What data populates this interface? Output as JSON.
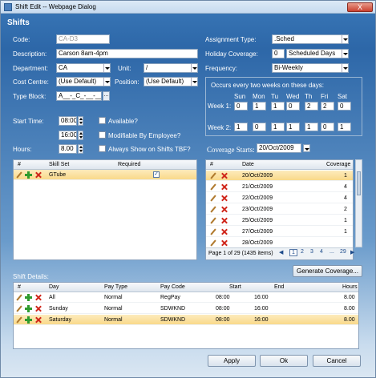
{
  "window": {
    "title": "Shift Edit -- Webpage Dialog",
    "close_glyph": "X"
  },
  "heading": "Shifts",
  "form": {
    "code_label": "Code:",
    "code_value": "CA-D3",
    "description_label": "Description:",
    "description_value": "Carson 8am-4pm",
    "department_label": "Department:",
    "department_value": "CA",
    "unit_label": "Unit:",
    "unit_value": "/",
    "cost_centre_label": "Cost Centre:",
    "cost_centre_value": "(Use Default)",
    "position_label": "Position:",
    "position_value": "(Use Default)",
    "type_block_label": "Type Block:",
    "type_block_value": "A__-_C_-__-__W",
    "ellipsis": "...",
    "start_time_label": "Start Time:",
    "start_time_value": "08:00",
    "end_time_value": "16:00",
    "hours_label": "Hours:",
    "hours_value": "8.00",
    "available_label": "Available?",
    "modifiable_label": "Modifiable By Employee?",
    "always_show_label": "Always Show on Shifts TBF?",
    "assignment_type_label": "Assignment Type:",
    "assignment_type_value": ".Sched",
    "holiday_coverage_label": "Holiday Coverage:",
    "holiday_coverage_value": "0",
    "holiday_coverage_unit": "Scheduled Days",
    "frequency_label": "Frequency:",
    "frequency_value": "Bi-Weekly"
  },
  "weeks": {
    "title": "Occurs every two weeks on these days:",
    "days": [
      "Sun",
      "Mon",
      "Tu",
      "Wed",
      "Th",
      "Fri",
      "Sat"
    ],
    "week1_label": "Week 1:",
    "week1": [
      "0",
      "1",
      "1",
      "0",
      "2",
      "2",
      "0"
    ],
    "week2_label": "Week 2:",
    "week2": [
      "1",
      "0",
      "1",
      "1",
      "1",
      "0",
      "1"
    ]
  },
  "coverage_starts": {
    "label": "Coverage Starts:",
    "value": "20/Oct/2009"
  },
  "skills_grid": {
    "headers": {
      "num": "#",
      "skill_set": "Skill Set",
      "required": "Required"
    },
    "rows": [
      {
        "skill": "GTube",
        "required": true
      }
    ]
  },
  "coverage_grid": {
    "headers": {
      "num": "#",
      "date": "Date",
      "coverage": "Coverage"
    },
    "rows": [
      {
        "date": "20/Oct/2009",
        "coverage": "1"
      },
      {
        "date": "21/Oct/2009",
        "coverage": "4"
      },
      {
        "date": "22/Oct/2009",
        "coverage": "4"
      },
      {
        "date": "23/Oct/2009",
        "coverage": "2"
      },
      {
        "date": "25/Oct/2009",
        "coverage": "1"
      },
      {
        "date": "27/Oct/2009",
        "coverage": "1"
      },
      {
        "date": "28/Oct/2009",
        "coverage": ""
      }
    ],
    "pager_text": "Page 1 of 29 (1435 items)",
    "pages": [
      "1",
      "2",
      "3",
      "4",
      "...",
      "29"
    ]
  },
  "generate_button": "Generate Coverage...",
  "shift_details": {
    "label": "Shift Details:",
    "headers": {
      "num": "#",
      "day": "Day",
      "pay_type": "Pay Type",
      "pay_code": "Pay Code",
      "start": "Start",
      "end": "End",
      "hours": "Hours"
    },
    "rows": [
      {
        "day": "All",
        "pay_type": "Normal",
        "pay_code": "RegPay",
        "start": "08:00",
        "end": "16:00",
        "hours": "8.00"
      },
      {
        "day": "Sunday",
        "pay_type": "Normal",
        "pay_code": "SDWKND",
        "start": "08:00",
        "end": "16:00",
        "hours": "8.00"
      },
      {
        "day": "Saturday",
        "pay_type": "Normal",
        "pay_code": "SDWKND",
        "start": "08:00",
        "end": "16:00",
        "hours": "8.00"
      }
    ]
  },
  "buttons": {
    "apply": "Apply",
    "ok": "Ok",
    "cancel": "Cancel"
  }
}
